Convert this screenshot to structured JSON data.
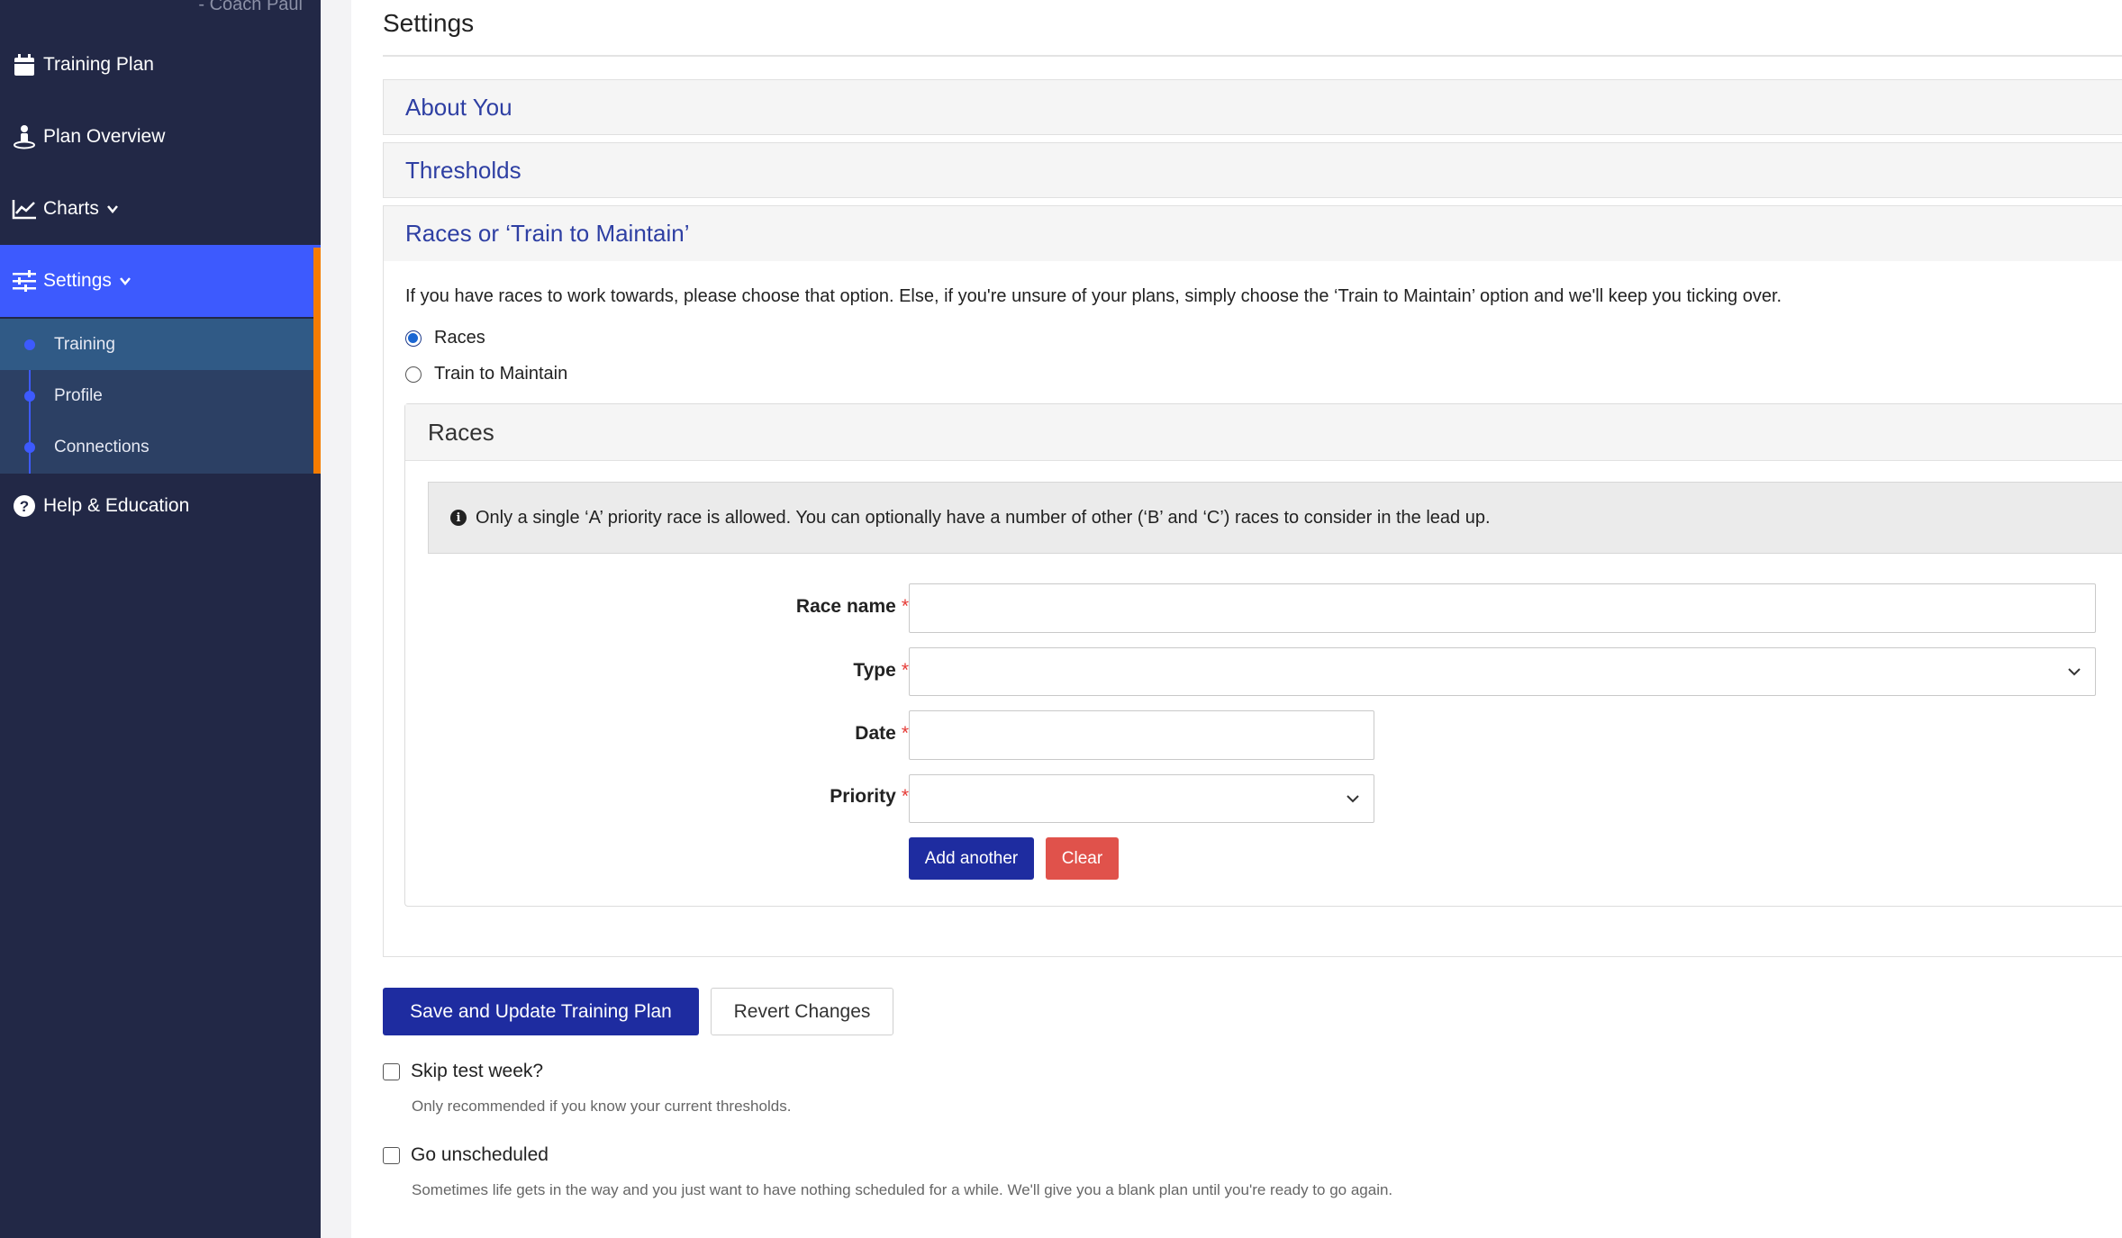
{
  "sidebar": {
    "coach": "- Coach Paul",
    "items": [
      {
        "label": "Training Plan",
        "icon": "calendar-icon"
      },
      {
        "label": "Plan Overview",
        "icon": "person-pin-icon"
      },
      {
        "label": "Charts",
        "icon": "line-chart-icon"
      },
      {
        "label": "Settings",
        "icon": "sliders-icon"
      },
      {
        "label": "Help & Education",
        "icon": "question-circle-icon"
      }
    ],
    "subitems": [
      {
        "label": "Training"
      },
      {
        "label": "Profile"
      },
      {
        "label": "Connections"
      }
    ]
  },
  "main": {
    "title": "Settings",
    "panels": {
      "about": "About You",
      "thresholds": "Thresholds",
      "races": "Races or ‘Train to Maintain’"
    },
    "intro": "If you have races to work towards, please choose that option. Else, if you're unsure of your plans, simply choose the ‘Train to Maintain’ option and we'll keep you ticking over.",
    "radio": {
      "races": "Races",
      "maintain": "Train to Maintain",
      "selected": "Races"
    },
    "races_box": {
      "title": "Races",
      "info": "Only a single ‘A’ priority race is allowed. You can optionally have a number of other (‘B’ and ‘C’) races to consider in the lead up.",
      "fields": {
        "race_name": {
          "label": "Race name",
          "value": ""
        },
        "type": {
          "label": "Type",
          "value": ""
        },
        "date": {
          "label": "Date",
          "value": ""
        },
        "priority": {
          "label": "Priority",
          "value": ""
        }
      },
      "required_marker": "*",
      "add_another": "Add another",
      "clear": "Clear"
    },
    "save": "Save and Update Training Plan",
    "revert": "Revert Changes",
    "skip_test": {
      "label": "Skip test week?",
      "help": "Only recommended if you know your current thresholds.",
      "checked": false
    },
    "unscheduled": {
      "label": "Go unscheduled",
      "help": "Sometimes life gets in the way and you just want to have nothing scheduled for a while. We'll give you a blank plan until you're ready to go again.",
      "checked": false
    }
  },
  "colors": {
    "sidebar_bg": "#222846",
    "active_nav": "#3d5afe",
    "accent": "#f57c00",
    "link": "#2e3fa3",
    "primary": "#1e2ca0",
    "danger": "#e0524b"
  }
}
